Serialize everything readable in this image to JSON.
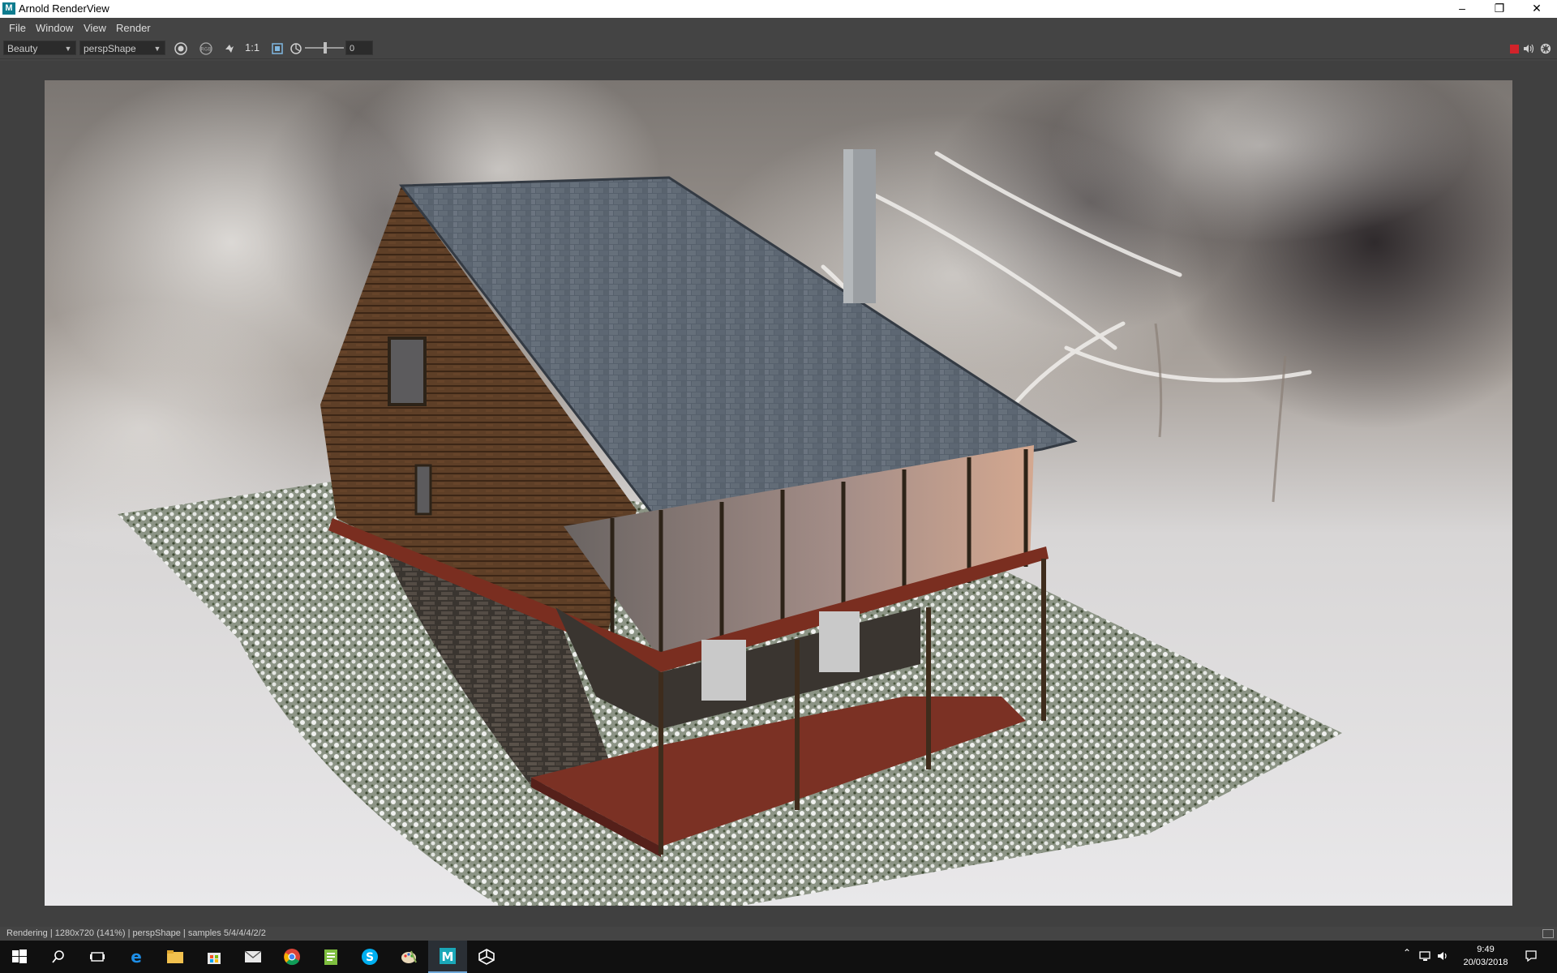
{
  "window": {
    "title": "Arnold RenderView",
    "app_icon_letter": "M",
    "controls": [
      "minimize-icon",
      "restore-icon",
      "close-icon"
    ]
  },
  "menubar": {
    "items": [
      "File",
      "Window",
      "View",
      "Render"
    ]
  },
  "toolbar": {
    "aov": "Beauty",
    "camera": "perspShape",
    "zoom_label": "1:1",
    "exposure_value": "0",
    "icons": [
      "display-settings-icon",
      "rgb-channels-icon",
      "crop-icon",
      "frame-icon",
      "snapshot-icon",
      "stop-render-icon",
      "audio-icon",
      "gear-icon"
    ]
  },
  "render": {
    "description": "house-render-snow-scene",
    "colors": {
      "roof": "#5a6470",
      "wood": "#5b3b24",
      "deck": "#7a2e20",
      "snow": "#e6e6e9",
      "moss": "#5e6a4a"
    }
  },
  "statusbar": {
    "text": "Rendering | 1280x720 (141%) | perspShape  | samples 5/4/4/4/2/2"
  },
  "taskbar": {
    "apps": [
      "windows-start-icon",
      "search-icon",
      "task-view-icon",
      "edge-icon",
      "file-explorer-icon",
      "store-icon",
      "mail-icon",
      "chrome-icon",
      "notepad-icon",
      "skype-icon",
      "paint-icon",
      "maya-icon",
      "unity-icon"
    ],
    "clock_time": "9:49",
    "clock_date": "20/03/2018"
  }
}
